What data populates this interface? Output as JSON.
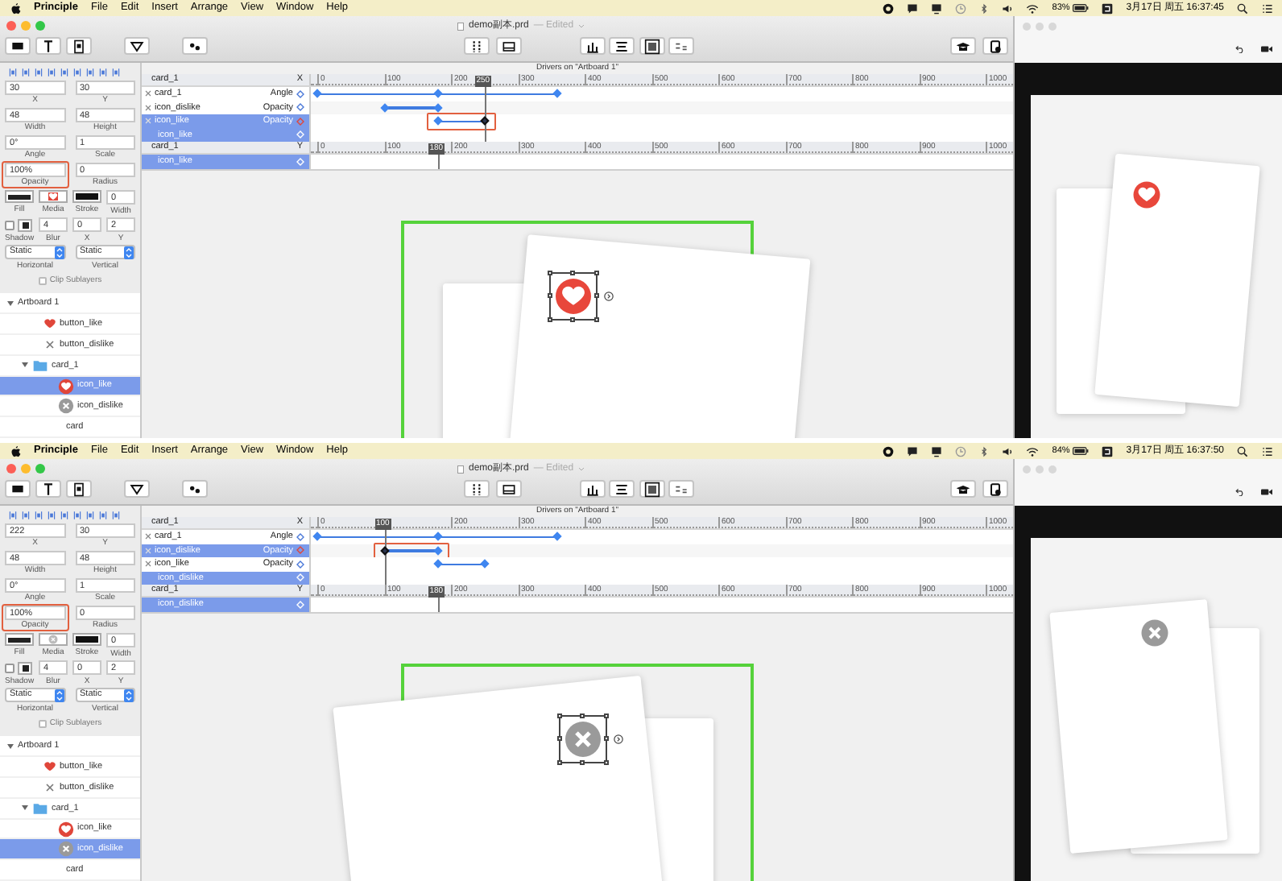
{
  "screens": [
    {
      "menubar": {
        "app": "Principle",
        "menus": [
          "File",
          "Edit",
          "Insert",
          "Arrange",
          "View",
          "Window",
          "Help"
        ],
        "battery": "83%",
        "clock": "3月17日 周五 16:37:45"
      },
      "document": {
        "name": "demo副本.prd",
        "state": "— Edited"
      },
      "toolbar": [
        {
          "kind": "rectangle"
        },
        {
          "kind": "text"
        },
        {
          "kind": "image"
        },
        {
          "kind": "component"
        },
        {
          "kind": "link"
        },
        {
          "kind": "columns"
        },
        {
          "kind": "screen"
        },
        {
          "kind": "distribute"
        },
        {
          "kind": "align"
        },
        {
          "kind": "crop"
        },
        {
          "kind": "arrange"
        },
        {
          "kind": "cap"
        },
        {
          "kind": "export"
        }
      ],
      "inspector": {
        "fields": [
          {
            "label": "X",
            "value": "30"
          },
          {
            "label": "Y",
            "value": "30"
          },
          {
            "label": "Width",
            "value": "48"
          },
          {
            "label": "Height",
            "value": "48"
          },
          {
            "label": "Angle",
            "value": "0°"
          },
          {
            "label": "Scale",
            "value": "1"
          },
          {
            "label": "Opacity",
            "value": "100%",
            "highlighted": true
          },
          {
            "label": "Radius",
            "value": "0"
          }
        ],
        "style_row": [
          {
            "kind": "fill",
            "label": "Fill"
          },
          {
            "kind": "media-like",
            "label": "Media"
          },
          {
            "kind": "stroke",
            "label": "Stroke"
          },
          {
            "kind": "input",
            "label": "Width",
            "value": "0"
          }
        ],
        "shadow_row": [
          {
            "kind": "toggle",
            "label": "Shadow",
            "checked": false
          },
          {
            "kind": "input",
            "label": "Blur",
            "value": "4"
          },
          {
            "kind": "input",
            "label": "X",
            "value": "0"
          },
          {
            "kind": "input",
            "label": "Y",
            "value": "2"
          }
        ],
        "selects": [
          {
            "value": "Static",
            "label": "Horizontal"
          },
          {
            "value": "Static",
            "label": "Vertical"
          }
        ],
        "clip": {
          "label": "Clip Sublayers",
          "checked": false
        }
      },
      "layers": [
        {
          "name": "Artboard 1",
          "expanded": true,
          "selected": false,
          "children": [
            {
              "name": "button_like",
              "kind": "heart",
              "selected": false
            },
            {
              "name": "button_dislike",
              "kind": "x",
              "selected": false
            },
            {
              "name": "card_1",
              "kind": "folder",
              "expanded": true,
              "selected": false,
              "children": [
                {
                  "name": "icon_like",
                  "kind": "like-circle",
                  "selected": true
                },
                {
                  "name": "icon_dislike",
                  "kind": "dislike-circle",
                  "selected": false
                }
              ]
            },
            {
              "name": "card",
              "selected": false
            }
          ]
        }
      ],
      "drivers": {
        "title": "Drivers on \"Artboard 1\"",
        "groups": [
          {
            "source": "card_1",
            "property": "X",
            "playhead": "250",
            "ticks": [
              "0",
              "100",
              "200",
              "300",
              "400",
              "500",
              "600",
              "700",
              "800",
              "900",
              "1000"
            ],
            "rows": [
              {
                "kind": "property",
                "layer": "card_1",
                "property": "Angle",
                "selected": false,
                "keyframes": [
                  {
                    "level": 0,
                    "selected": false
                  },
                  {
                    "level": 0.18,
                    "selected": false
                  },
                  {
                    "level": 0.36,
                    "selected": false
                  }
                ]
              },
              {
                "kind": "property",
                "layer": "icon_dislike",
                "property": "Opacity",
                "selected": false,
                "keyframes": [
                  {
                    "level": 0.1,
                    "selected": false
                  },
                  {
                    "level": 0.18,
                    "selected": false
                  }
                ]
              },
              {
                "kind": "property",
                "layer": "icon_like",
                "property": "Opacity",
                "selected": true,
                "highlighted": true,
                "keyframes": [
                  {
                    "level": 0.18,
                    "selected": false
                  },
                  {
                    "level": 0.25,
                    "selected": true
                  }
                ]
              },
              {
                "kind": "output",
                "layer": "icon_like",
                "selected": true
              }
            ]
          },
          {
            "source": "card_1",
            "property": "Y",
            "playhead": "180",
            "ticks": [
              "0",
              "100",
              "200",
              "300",
              "400",
              "500",
              "600",
              "700",
              "800",
              "900",
              "1000"
            ],
            "rows": [
              {
                "kind": "output",
                "layer": "icon_like",
                "selected": true
              }
            ]
          }
        ]
      },
      "canvas": {
        "kind": "like"
      },
      "preview": {
        "kind": "like"
      }
    },
    {
      "menubar": {
        "app": "Principle",
        "menus": [
          "File",
          "Edit",
          "Insert",
          "Arrange",
          "View",
          "Window",
          "Help"
        ],
        "battery": "84%",
        "clock": "3月17日 周五 16:37:50"
      },
      "document": {
        "name": "demo副本.prd",
        "state": "— Edited"
      },
      "toolbar": [
        {
          "kind": "rectangle"
        },
        {
          "kind": "text"
        },
        {
          "kind": "image"
        },
        {
          "kind": "component"
        },
        {
          "kind": "link"
        },
        {
          "kind": "columns"
        },
        {
          "kind": "screen"
        },
        {
          "kind": "distribute"
        },
        {
          "kind": "align"
        },
        {
          "kind": "crop"
        },
        {
          "kind": "arrange"
        },
        {
          "kind": "cap"
        },
        {
          "kind": "export"
        }
      ],
      "inspector": {
        "fields": [
          {
            "label": "X",
            "value": "222"
          },
          {
            "label": "Y",
            "value": "30"
          },
          {
            "label": "Width",
            "value": "48"
          },
          {
            "label": "Height",
            "value": "48"
          },
          {
            "label": "Angle",
            "value": "0°"
          },
          {
            "label": "Scale",
            "value": "1"
          },
          {
            "label": "Opacity",
            "value": "100%",
            "highlighted": true
          },
          {
            "label": "Radius",
            "value": "0"
          }
        ],
        "style_row": [
          {
            "kind": "fill",
            "label": "Fill"
          },
          {
            "kind": "media-dislike",
            "label": "Media"
          },
          {
            "kind": "stroke",
            "label": "Stroke"
          },
          {
            "kind": "input",
            "label": "Width",
            "value": "0"
          }
        ],
        "shadow_row": [
          {
            "kind": "toggle",
            "label": "Shadow",
            "checked": false
          },
          {
            "kind": "input",
            "label": "Blur",
            "value": "4"
          },
          {
            "kind": "input",
            "label": "X",
            "value": "0"
          },
          {
            "kind": "input",
            "label": "Y",
            "value": "2"
          }
        ],
        "selects": [
          {
            "value": "Static",
            "label": "Horizontal"
          },
          {
            "value": "Static",
            "label": "Vertical"
          }
        ],
        "clip": {
          "label": "Clip Sublayers",
          "checked": false
        }
      },
      "layers": [
        {
          "name": "Artboard 1",
          "expanded": true,
          "selected": false,
          "children": [
            {
              "name": "button_like",
              "kind": "heart",
              "selected": false
            },
            {
              "name": "button_dislike",
              "kind": "x",
              "selected": false
            },
            {
              "name": "card_1",
              "kind": "folder",
              "expanded": true,
              "selected": false,
              "children": [
                {
                  "name": "icon_like",
                  "kind": "like-circle",
                  "selected": false
                },
                {
                  "name": "icon_dislike",
                  "kind": "dislike-circle",
                  "selected": true
                }
              ]
            },
            {
              "name": "card",
              "selected": false
            }
          ]
        }
      ],
      "drivers": {
        "title": "Drivers on \"Artboard 1\"",
        "groups": [
          {
            "source": "card_1",
            "property": "X",
            "playhead": "100",
            "ticks": [
              "0",
              "200",
              "300",
              "400",
              "500",
              "600",
              "700",
              "800",
              "900",
              "1000"
            ],
            "rows": [
              {
                "kind": "property",
                "layer": "card_1",
                "property": "Angle",
                "selected": false,
                "keyframes": [
                  {
                    "level": 0,
                    "selected": false
                  },
                  {
                    "level": 0.18,
                    "selected": false
                  },
                  {
                    "level": 0.36,
                    "selected": false
                  }
                ]
              },
              {
                "kind": "property",
                "layer": "icon_dislike",
                "property": "Opacity",
                "selected": true,
                "highlighted": true,
                "keyframes": [
                  {
                    "level": 0.1,
                    "selected": true
                  },
                  {
                    "level": 0.18,
                    "selected": false
                  }
                ]
              },
              {
                "kind": "property",
                "layer": "icon_like",
                "property": "Opacity",
                "selected": false,
                "keyframes": [
                  {
                    "level": 0.18,
                    "selected": false
                  },
                  {
                    "level": 0.25,
                    "selected": false
                  }
                ]
              },
              {
                "kind": "output",
                "layer": "icon_dislike",
                "selected": true
              }
            ]
          },
          {
            "source": "card_1",
            "property": "Y",
            "playhead": "180",
            "ticks": [
              "0",
              "100",
              "200",
              "300",
              "400",
              "500",
              "600",
              "700",
              "800",
              "900",
              "1000"
            ],
            "rows": [
              {
                "kind": "output",
                "layer": "icon_dislike",
                "selected": true
              }
            ]
          }
        ]
      },
      "canvas": {
        "kind": "dislike"
      },
      "preview": {
        "kind": "dislike"
      }
    }
  ]
}
